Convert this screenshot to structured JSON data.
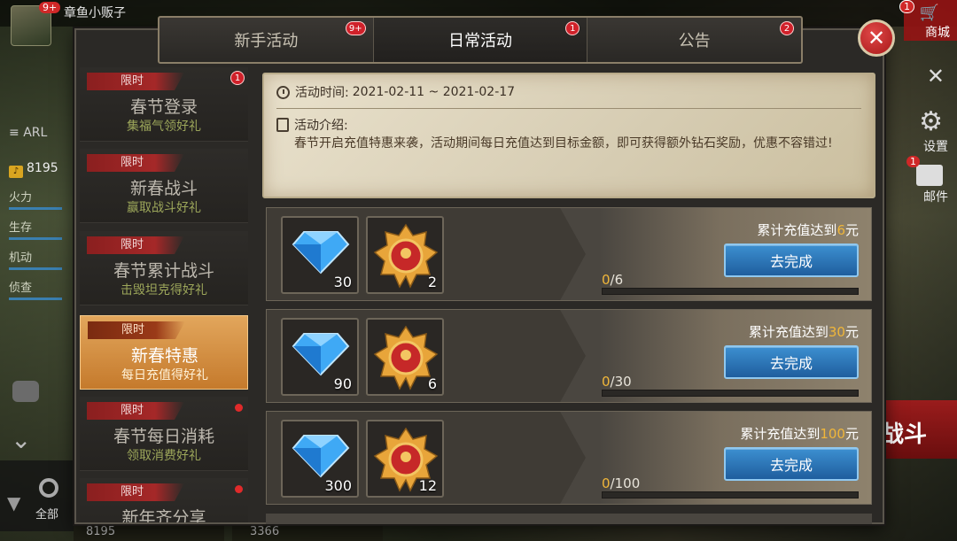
{
  "background": {
    "player_name": "章鱼小贩子",
    "avatar_badge": "9+",
    "rank_text": "ARL",
    "gold": "8195",
    "stats": [
      "火力",
      "生存",
      "机动",
      "侦查"
    ],
    "shop_label": "商城",
    "shop_badge": "1",
    "settings_label": "设置",
    "mail_label": "邮件",
    "mail_badge": "1",
    "battle_label": "战斗",
    "all_label": "全部",
    "bottom_gold_1": "8195",
    "bottom_gold_2": "3366"
  },
  "tabs": [
    {
      "label": "新手活动",
      "badge": "9+",
      "active": false
    },
    {
      "label": "日常活动",
      "badge": "1",
      "active": true
    },
    {
      "label": "公告",
      "badge": "2",
      "active": false
    }
  ],
  "sidebar": {
    "items": [
      {
        "tag": "限时",
        "title": "春节登录",
        "subtitle": "集福气领好礼",
        "badge": "1"
      },
      {
        "tag": "限时",
        "title": "新春战斗",
        "subtitle": "赢取战斗好礼"
      },
      {
        "tag": "限时",
        "title": "春节累计战斗",
        "subtitle": "击毁坦克得好礼"
      },
      {
        "tag": "限时",
        "title": "新春特惠",
        "subtitle": "每日充值得好礼",
        "active": true
      },
      {
        "tag": "限时",
        "title": "春节每日消耗",
        "subtitle": "领取消费好礼",
        "dot": true
      },
      {
        "tag": "限时",
        "title": "新年齐分享",
        "subtitle": "",
        "dot": true
      }
    ]
  },
  "info": {
    "time_label": "活动时间:",
    "time_value": "2021-02-11 ~ 2021-02-17",
    "intro_label": "活动介绍:",
    "intro_text": "春节开启充值特惠来袭，活动期间每日充值达到目标金额，即可获得额外钻石奖励，优惠不容错过!"
  },
  "rewards": [
    {
      "diamonds": "30",
      "medals": "2",
      "goal_prefix": "累计充值达到",
      "goal_amount": "6",
      "goal_suffix": "元",
      "progress_cur": "0",
      "progress_total": "/6",
      "progress": 0,
      "button": "去完成"
    },
    {
      "diamonds": "90",
      "medals": "6",
      "goal_prefix": "累计充值达到",
      "goal_amount": "30",
      "goal_suffix": "元",
      "progress_cur": "0",
      "progress_total": "/30",
      "progress": 0,
      "button": "去完成"
    },
    {
      "diamonds": "300",
      "medals": "12",
      "goal_prefix": "累计充值达到",
      "goal_amount": "100",
      "goal_suffix": "元",
      "progress_cur": "0",
      "progress_total": "/100",
      "progress": 0,
      "button": "去完成"
    }
  ],
  "colors": {
    "accent_gold": "#f0b63a",
    "button_blue": "#2a75b8",
    "badge_red": "#d0212a",
    "active_tab_orange": "#d38e42"
  }
}
